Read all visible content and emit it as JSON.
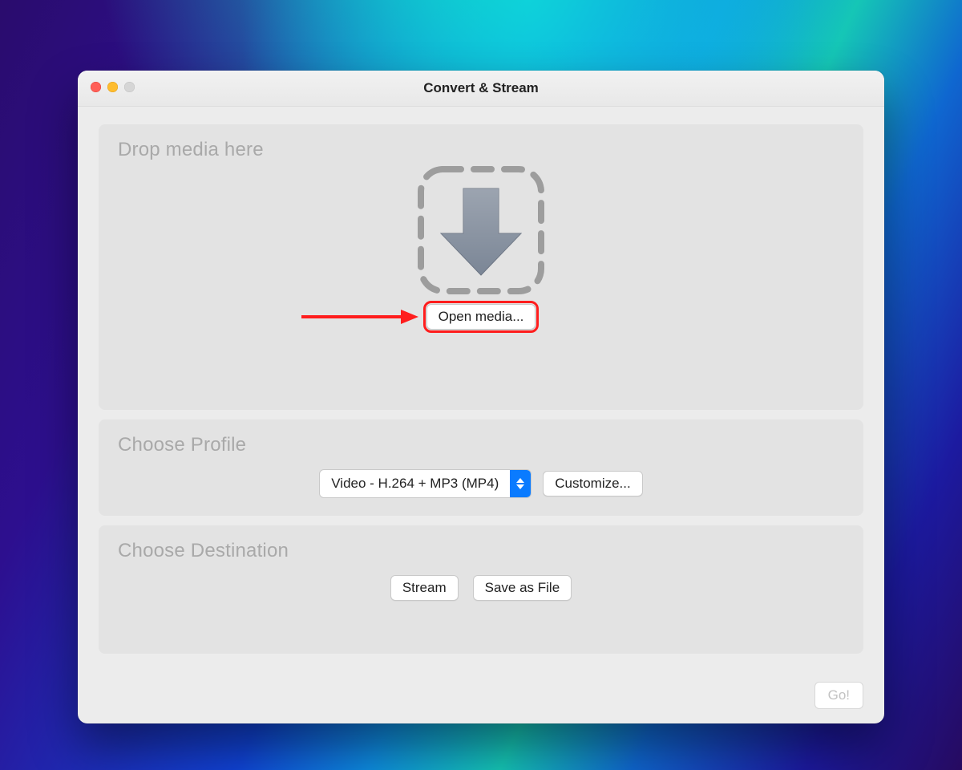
{
  "window": {
    "title": "Convert & Stream"
  },
  "drop": {
    "heading": "Drop media here",
    "open_button": "Open media..."
  },
  "profile": {
    "heading": "Choose Profile",
    "selected": "Video - H.264 + MP3 (MP4)",
    "customize": "Customize..."
  },
  "destination": {
    "heading": "Choose Destination",
    "stream": "Stream",
    "save": "Save as File"
  },
  "footer": {
    "go": "Go!"
  }
}
